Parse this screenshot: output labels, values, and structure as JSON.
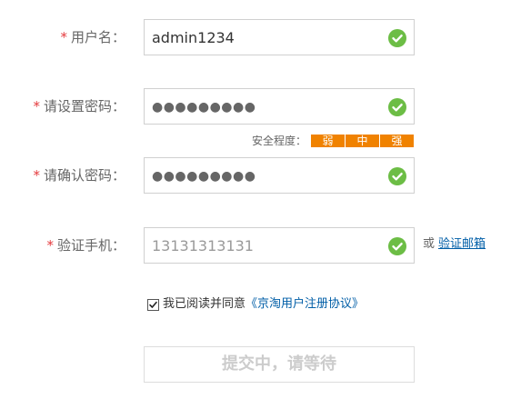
{
  "form": {
    "username": {
      "required_mark": "*",
      "label": "用户名：",
      "value": "admin1234",
      "status_icon": "check-circle-icon"
    },
    "password": {
      "required_mark": "*",
      "label": "请设置密码：",
      "masked_value": "●●●●●●●●●",
      "status_icon": "check-circle-icon"
    },
    "strength": {
      "label": "安全程度：",
      "levels": [
        "弱",
        "中",
        "强"
      ],
      "color": "#f08200"
    },
    "confirm_password": {
      "required_mark": "*",
      "label": "请确认密码：",
      "masked_value": "●●●●●●●●●",
      "status_icon": "check-circle-icon"
    },
    "phone": {
      "required_mark": "*",
      "label": "验证手机：",
      "value": "13131313131",
      "status_icon": "check-circle-icon",
      "or_text": "或",
      "email_link": "验证邮箱"
    },
    "agreement": {
      "checked": true,
      "text": "我已阅读并同意",
      "link": "《京淘用户注册协议》"
    },
    "submit": {
      "label": "提交中，请等待"
    }
  },
  "colors": {
    "required": "#e4393c",
    "check": "#6cbd45",
    "link": "#005ea7",
    "strength": "#f08200"
  }
}
